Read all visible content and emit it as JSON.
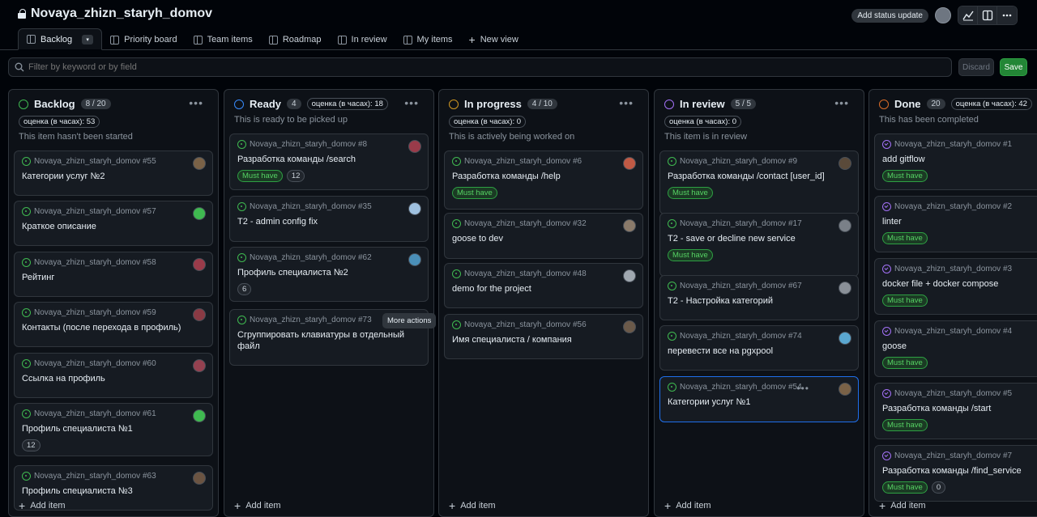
{
  "header": {
    "project_title": "Novaya_zhizn_staryh_domov",
    "status_button": "Add status update"
  },
  "tabs": [
    {
      "label": "Backlog"
    },
    {
      "label": "Priority board"
    },
    {
      "label": "Team items"
    },
    {
      "label": "Roadmap"
    },
    {
      "label": "In review"
    },
    {
      "label": "My items"
    }
  ],
  "new_view_label": "New view",
  "filter": {
    "placeholder": "Filter by keyword or by field",
    "discard_label": "Discard",
    "save_label": "Save"
  },
  "tooltip": "More actions",
  "add_item_label": "Add item",
  "columns": [
    {
      "name": "Backlog",
      "count": "8 / 20",
      "estimate": "оценка (в часах): 53",
      "description": "This item hasn't been started",
      "color": "#3fb950",
      "cards": [
        {
          "ref": "Novaya_zhizn_staryh_domov #55",
          "title": "Категории услуг №2"
        },
        {
          "ref": "Novaya_zhizn_staryh_domov #57",
          "title": "Краткое описание"
        },
        {
          "ref": "Novaya_zhizn_staryh_domov #58",
          "title": "Рейтинг"
        },
        {
          "ref": "Novaya_zhizn_staryh_domov #59",
          "title": "Контакты (после перехода в профиль)"
        },
        {
          "ref": "Novaya_zhizn_staryh_domov #60",
          "title": "Ссылка на профиль"
        },
        {
          "ref": "Novaya_zhizn_staryh_domov #61",
          "title": "Профиль специалиста №1",
          "num": "12"
        },
        {
          "ref": "Novaya_zhizn_staryh_domov #63",
          "title": "Профиль специалиста №3"
        }
      ]
    },
    {
      "name": "Ready",
      "count": "4",
      "estimate": "оценка (в часах): 18",
      "description": "This is ready to be picked up",
      "color": "#388bfd",
      "cards": [
        {
          "ref": "Novaya_zhizn_staryh_domov #8",
          "title": "Разработка команды /search",
          "must": "Must have",
          "num": "12"
        },
        {
          "ref": "Novaya_zhizn_staryh_domov #35",
          "title": "T2 - admin config fix"
        },
        {
          "ref": "Novaya_zhizn_staryh_domov #62",
          "title": "Профиль специалиста №2",
          "num": "6"
        },
        {
          "ref": "Novaya_zhizn_staryh_domov #73",
          "title": "Сгруппировать клавиатуры в отдельный файл"
        }
      ]
    },
    {
      "name": "In progress",
      "count": "4 / 10",
      "estimate": "оценка (в часах): 0",
      "description": "This is actively being worked on",
      "color": "#d29922",
      "cards": [
        {
          "ref": "Novaya_zhizn_staryh_domov #6",
          "title": "Разработка команды /help",
          "must": "Must have"
        },
        {
          "ref": "Novaya_zhizn_staryh_domov #32",
          "title": "goose to dev"
        },
        {
          "ref": "Novaya_zhizn_staryh_domov #48",
          "title": "demo for the project"
        },
        {
          "ref": "Novaya_zhizn_staryh_domov #56",
          "title": "Имя специалиста / компания"
        }
      ]
    },
    {
      "name": "In review",
      "count": "5 / 5",
      "estimate": "оценка (в часах): 0",
      "description": "This item is in review",
      "color": "#a371f7",
      "cards": [
        {
          "ref": "Novaya_zhizn_staryh_domov #9",
          "title": "Разработка команды /contact [user_id]",
          "must": "Must have"
        },
        {
          "ref": "Novaya_zhizn_staryh_domov #17",
          "title": "T2 - save or decline new service",
          "must": "Must have"
        },
        {
          "ref": "Novaya_zhizn_staryh_domov #67",
          "title": "T2 - Настройка категорий"
        },
        {
          "ref": "Novaya_zhizn_staryh_domov #74",
          "title": "перевести все на pgxpool"
        },
        {
          "ref": "Novaya_zhizn_staryh_domov #54",
          "title": "Категории услуг №1"
        }
      ]
    },
    {
      "name": "Done",
      "count": "20",
      "estimate": "оценка (в часах): 42",
      "description": "This has been completed",
      "color": "#db6d28",
      "cards": [
        {
          "ref": "Novaya_zhizn_staryh_domov #1",
          "title": "add gitflow",
          "must": "Must have"
        },
        {
          "ref": "Novaya_zhizn_staryh_domov #2",
          "title": "linter",
          "must": "Must have"
        },
        {
          "ref": "Novaya_zhizn_staryh_domov #3",
          "title": "docker file + docker compose",
          "must": "Must have"
        },
        {
          "ref": "Novaya_zhizn_staryh_domov #4",
          "title": "goose",
          "must": "Must have"
        },
        {
          "ref": "Novaya_zhizn_staryh_domov #5",
          "title": "Разработка команды /start",
          "must": "Must have"
        },
        {
          "ref": "Novaya_zhizn_staryh_domov #7",
          "title": "Разработка команды /find_service",
          "must": "Must have",
          "num": "0"
        }
      ]
    }
  ]
}
